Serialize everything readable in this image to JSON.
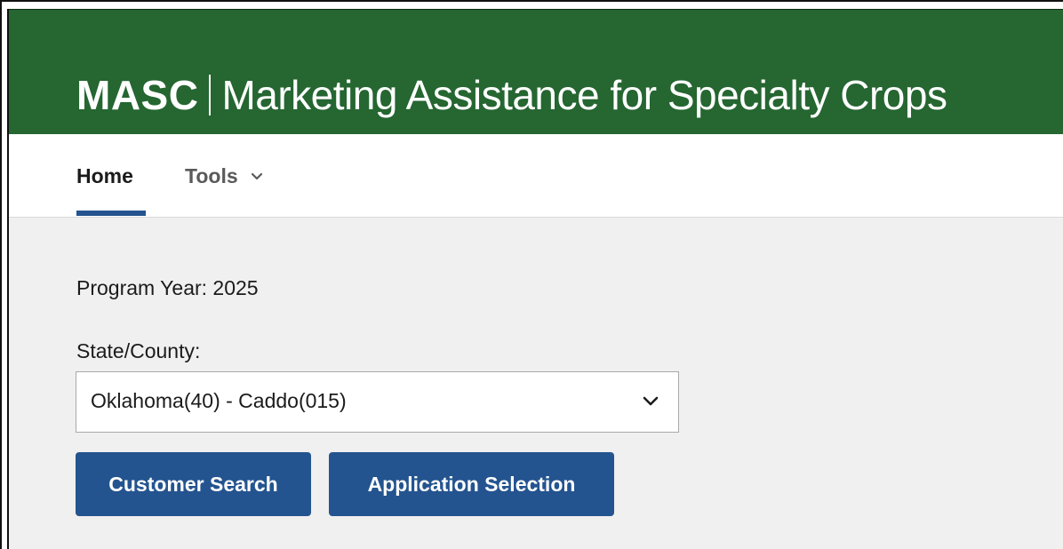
{
  "header": {
    "acronym": "MASC",
    "title": "Marketing Assistance for Specialty Crops",
    "background_color": "#256631"
  },
  "nav": {
    "items": [
      {
        "label": "Home",
        "active": true
      },
      {
        "label": "Tools",
        "has_dropdown": true,
        "icon": "chevron-down-icon"
      }
    ],
    "active_indicator_color": "#24548f"
  },
  "main": {
    "program_year_label": "Program Year: 2025",
    "state_county_label": "State/County:",
    "state_county_select": {
      "value": "Oklahoma(40) - Caddo(015)",
      "icon": "chevron-down-icon"
    },
    "buttons": [
      {
        "label": "Customer Search"
      },
      {
        "label": "Application Selection"
      }
    ],
    "button_color": "#24548f",
    "background_color": "#f0f0f0"
  }
}
